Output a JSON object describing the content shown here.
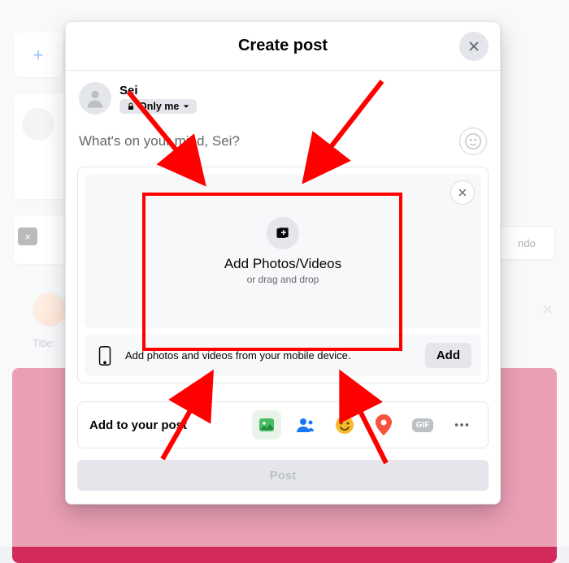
{
  "modal": {
    "title": "Create post",
    "user": {
      "name": "Sei"
    },
    "privacy": {
      "label": "Only me"
    },
    "placeholder": "What's on your mind, Sei?",
    "upload": {
      "title": "Add Photos/Videos",
      "subtitle": "or drag and drop"
    },
    "mobile_bar": {
      "text": "Add photos and videos from your mobile device.",
      "button": "Add"
    },
    "attach_label": "Add to your post",
    "post_button": "Post"
  },
  "background": {
    "plus": "+",
    "tag_text": "ndo",
    "title_label": "Title:",
    "badge": "×"
  },
  "icons": {
    "gif_label": "GIF"
  }
}
